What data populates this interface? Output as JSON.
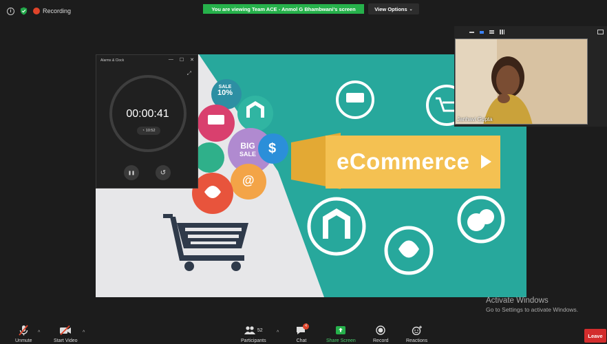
{
  "topbar": {
    "recording_label": "Recording",
    "banner_text": "You are viewing Team ACE - Anmol G Bhambwani's screen",
    "view_options_label": "View Options",
    "banner_color": "#26b14b"
  },
  "slide": {
    "headline": "eCommerce",
    "bubble_sale_top": "SALE",
    "bubble_sale_pct": "10%",
    "bubble_big": "BIG",
    "bubble_sale": "SALE",
    "bubble_dollar": "$",
    "bubble_at": "@",
    "teal_color": "#26a69a",
    "ribbon_color": "#f4c152"
  },
  "clock_window": {
    "title": "Alarms & Clock",
    "minimize": "—",
    "maximize": "☐",
    "close": "✕",
    "timer": "00:00:41",
    "alarm_time": "10:52",
    "pause_icon": "❚❚",
    "reset_icon": "↺"
  },
  "participant": {
    "name": "Janhavi Gupta"
  },
  "activate": {
    "line1": "Activate Windows",
    "line2": "Go to Settings to activate Windows."
  },
  "toolbar": {
    "unmute": "Unmute",
    "start_video": "Start Video",
    "participants": "Participants",
    "participants_count": "52",
    "chat": "Chat",
    "chat_badge": "4",
    "share_screen": "Share Screen",
    "record": "Record",
    "reactions": "Reactions",
    "leave": "Leave"
  }
}
